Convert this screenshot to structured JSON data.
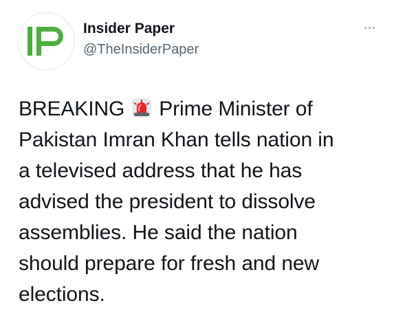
{
  "author": {
    "name": "Insider Paper",
    "handle": "@TheInsiderPaper",
    "avatar_initials": "IP",
    "avatar_colors": {
      "letter": "#4caf3f",
      "background": "#ffffff",
      "border": "#e1e8ed"
    }
  },
  "more_icon": "more-horizontal-icon",
  "tweet": {
    "line1_prefix": "BREAKING",
    "emoji_icon": "police-siren-icon",
    "line1_suffix": "Prime Minister of",
    "line2": "Pakistan Imran Khan tells nation in",
    "line3": "a televised address that he has",
    "line4": "advised the president to dissolve",
    "line5": "assemblies. He said the nation",
    "line6": "should prepare for fresh and new",
    "line7": "elections."
  },
  "colors": {
    "text": "#0f1419",
    "secondary": "#536471",
    "siren_red": "#e0262b"
  }
}
